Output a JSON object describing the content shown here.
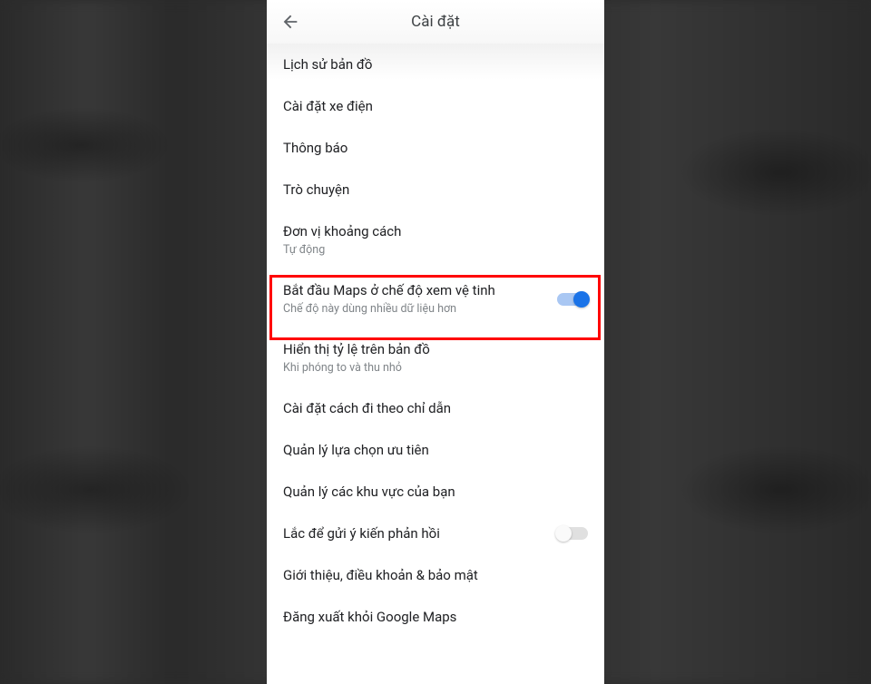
{
  "header": {
    "title": "Cài đặt"
  },
  "items": [
    {
      "label": "Lịch sử bản đồ"
    },
    {
      "label": "Cài đặt xe điện"
    },
    {
      "label": "Thông báo"
    },
    {
      "label": "Trò chuyện"
    },
    {
      "label": "Đơn vị khoảng cách",
      "sub": "Tự động"
    },
    {
      "label": "Bắt đầu Maps ở chế độ xem vệ tinh",
      "sub": "Chế độ này dùng nhiều dữ liệu hơn",
      "toggle": "on",
      "highlight": true
    },
    {
      "label": "Hiển thị tỷ lệ trên bản đồ",
      "sub": "Khi phóng to và thu nhỏ"
    },
    {
      "label": "Cài đặt cách đi theo chỉ dẫn"
    },
    {
      "label": "Quản lý lựa chọn ưu tiên"
    },
    {
      "label": "Quản lý các khu vực của bạn"
    },
    {
      "label": "Lắc để gửi ý kiến phản hồi",
      "toggle": "off"
    },
    {
      "label": "Giới thiệu, điều khoản & bảo mật"
    },
    {
      "label": "Đăng xuất khỏi Google Maps"
    }
  ]
}
